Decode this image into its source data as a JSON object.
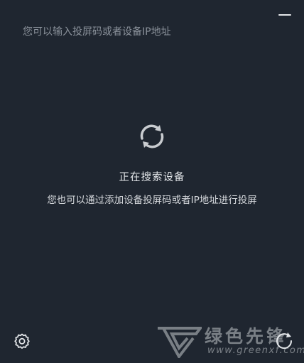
{
  "header": {
    "minimize_icon": "minimize-icon"
  },
  "search": {
    "placeholder": "您可以输入投屏码或者设备IP地址",
    "value": ""
  },
  "status": {
    "spinner_icon": "refresh-spinner-icon",
    "title": "正在搜索设备",
    "subtitle": "您也可以通过添加设备投屏码或者IP地址进行投屏"
  },
  "footer": {
    "settings_icon": "gear-icon",
    "refresh_icon": "refresh-icon"
  },
  "watermark": {
    "brand": "绿色先锋",
    "url": "www.greenxf.com"
  },
  "colors": {
    "background": "#1f2630",
    "text_primary": "#e3e6e9",
    "placeholder": "#8b929b",
    "icon": "#c9ccd0"
  }
}
